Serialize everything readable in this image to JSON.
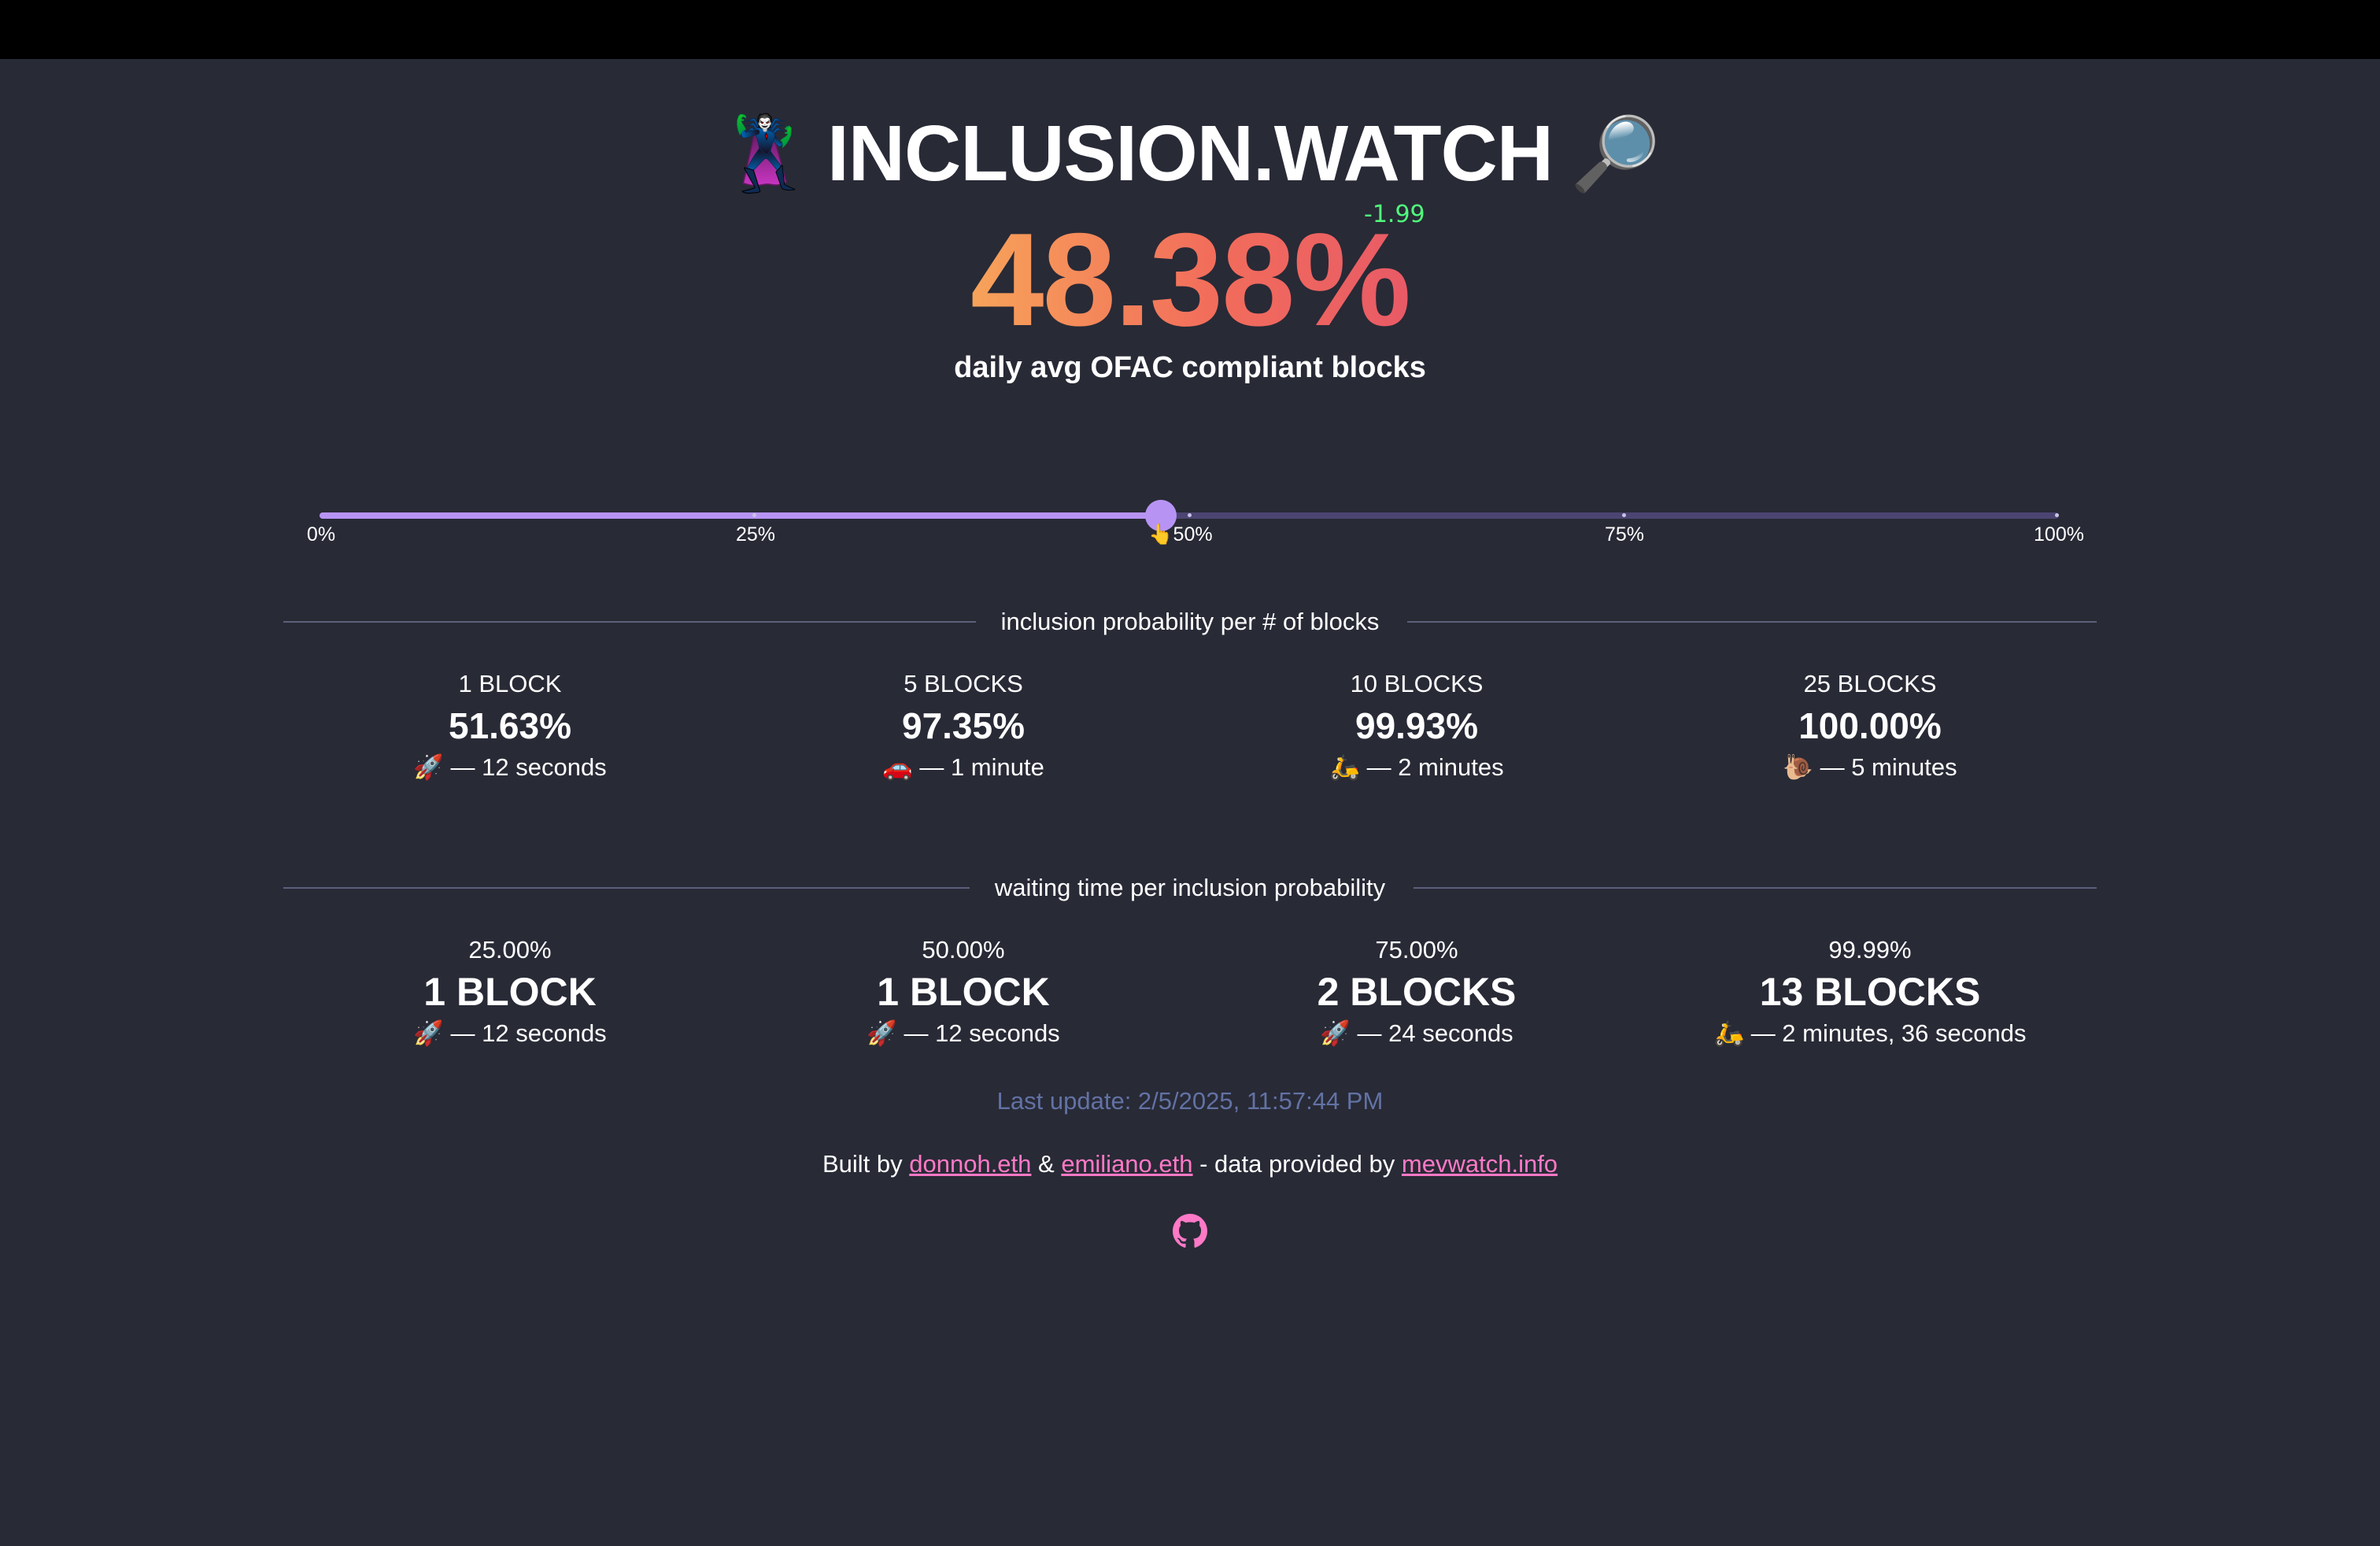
{
  "header": {
    "left_emoji": "🦹",
    "title": "INCLUSION.WATCH",
    "right_emoji": "🔎"
  },
  "stat": {
    "value": "48.38%",
    "delta": "-1.99",
    "label": "daily avg OFAC compliant blocks"
  },
  "slider": {
    "value_percent": 48.38,
    "labels": [
      "0%",
      "25%",
      "👆50%",
      "75%",
      "100%"
    ]
  },
  "section_blocks": {
    "title": "inclusion probability per # of blocks",
    "items": [
      {
        "head": "1 BLOCK",
        "value": "51.63%",
        "time": "🚀 — 12 seconds"
      },
      {
        "head": "5 BLOCKS",
        "value": "97.35%",
        "time": "🚗 — 1 minute"
      },
      {
        "head": "10 BLOCKS",
        "value": "99.93%",
        "time": "🛵 — 2 minutes"
      },
      {
        "head": "25 BLOCKS",
        "value": "100.00%",
        "time": "🐌 — 5 minutes"
      }
    ]
  },
  "section_wait": {
    "title": "waiting time per inclusion probability",
    "items": [
      {
        "head": "25.00%",
        "value": "1 BLOCK",
        "time": "🚀 — 12 seconds"
      },
      {
        "head": "50.00%",
        "value": "1 BLOCK",
        "time": "🚀 — 12 seconds"
      },
      {
        "head": "75.00%",
        "value": "2 BLOCKS",
        "time": "🚀 — 24 seconds"
      },
      {
        "head": "99.99%",
        "value": "13 BLOCKS",
        "time": "🛵 — 2 minutes, 36 seconds"
      }
    ]
  },
  "footer": {
    "last_update": "Last update: 2/5/2025, 11:57:44 PM",
    "built_by": "Built by",
    "author1": "donnoh.eth",
    "amp": "&",
    "author2": "emiliano.eth",
    "data_by": "- data provided by",
    "source": "mevwatch.info",
    "github_icon": "github-icon"
  },
  "colors": {
    "background": "#282a36",
    "accent": "#b794f4",
    "link": "#ff79c6",
    "delta": "#50fa7b",
    "muted": "#6272a4"
  }
}
